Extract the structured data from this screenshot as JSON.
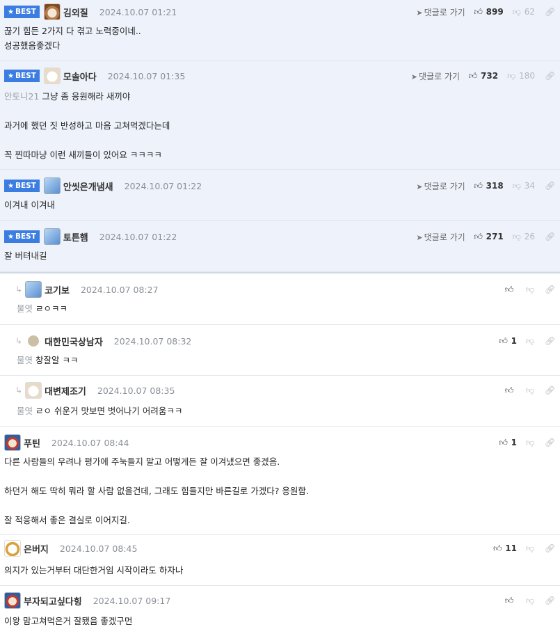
{
  "labels": {
    "best": "BEST",
    "goto_reply": "댓글로 가기"
  },
  "comments": [
    {
      "name": "김외질",
      "date": "2024.10.07 01:21",
      "likes": "899",
      "dislikes": "62",
      "mention": "",
      "text": "끊기 힘든 2가지 다 겪고 노력중이네..\n성공했음좋겠다"
    },
    {
      "name": "모솔아다",
      "date": "2024.10.07 01:35",
      "likes": "732",
      "dislikes": "180",
      "mention": "안토니21",
      "text": "그냥 좀 응원해라 새끼야\n\n과거에 했던 짓 반성하고 마음 고쳐먹겠다는데\n\n꼭 찐따마냥 이런 새끼들이 있어요 ㅋㅋㅋㅋ"
    },
    {
      "name": "안씻은개냄새",
      "date": "2024.10.07 01:22",
      "likes": "318",
      "dislikes": "34",
      "mention": "",
      "text": "이겨내 이겨내"
    },
    {
      "name": "토튼햄",
      "date": "2024.10.07 01:22",
      "likes": "271",
      "dislikes": "26",
      "mention": "",
      "text": "잘 버텨내길"
    },
    {
      "name": "코기보",
      "date": "2024.10.07 08:27",
      "likes": "",
      "dislikes": "",
      "mention": "물엿",
      "text": "ㄹㅇㅋㅋ"
    },
    {
      "name": "대한민국상남자",
      "date": "2024.10.07 08:32",
      "likes": "1",
      "dislikes": "",
      "mention": "물엿",
      "text": "창잘알 ㅋㅋ"
    },
    {
      "name": "대변제조기",
      "date": "2024.10.07 08:35",
      "likes": "",
      "dislikes": "",
      "mention": "물엿",
      "text": "ㄹㅇ 쉬운거 맛보면 벗어나기 어려움ㅋㅋ"
    },
    {
      "name": "푸틴",
      "date": "2024.10.07 08:44",
      "likes": "1",
      "dislikes": "",
      "mention": "",
      "text": "다른 사람들의 우려나 평가에 주눅들지 말고 어떻게든 잘 이겨냈으면 좋겠음.\n\n하던거 해도 딱히 뭐라 할 사람 없을건데, 그래도 힘들지만 바른길로 가겠다? 응원함.\n\n잘 적응해서 좋은 결실로 이어지길."
    },
    {
      "name": "은버지",
      "date": "2024.10.07 08:45",
      "likes": "11",
      "dislikes": "",
      "mention": "",
      "text": "의지가 있는거부터 대단한거임 시작이라도 하자나"
    },
    {
      "name": "부자되고싶다힝",
      "date": "2024.10.07 09:17",
      "likes": "",
      "dislikes": "",
      "mention": "",
      "text": "이왕 맘고쳐먹은거 잘됐음 좋겠구먼"
    }
  ]
}
